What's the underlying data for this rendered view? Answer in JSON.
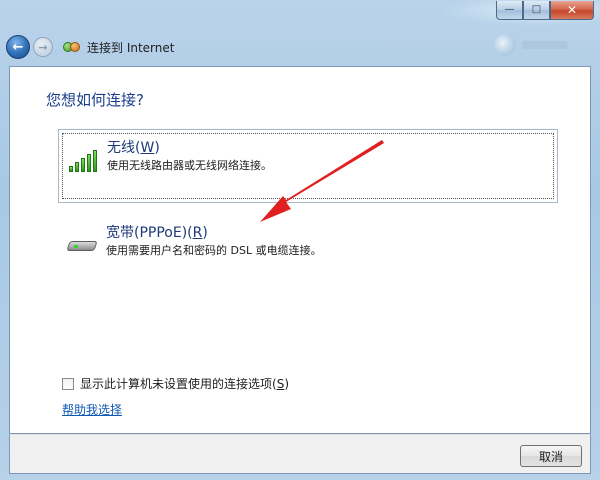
{
  "window": {
    "title": "连接到 Internet",
    "caption": {
      "minimize": "—",
      "maximize": "□",
      "close": "✕"
    }
  },
  "nav": {
    "back_icon": "back-arrow-icon",
    "forward_icon": "forward-arrow-icon"
  },
  "content": {
    "question": "您想如何连接?",
    "options": [
      {
        "title": "无线(",
        "accel": "W",
        "title_end": ")",
        "desc": "使用无线路由器或无线网络连接。",
        "icon": "wireless-signal-icon",
        "selected": true
      },
      {
        "title": "宽带(PPPoE)(",
        "accel": "R",
        "title_end": ")",
        "desc": "使用需要用户名和密码的 DSL 或电缆连接。",
        "icon": "broadband-modem-icon",
        "selected": false
      }
    ],
    "checkbox": {
      "label": "显示此计算机未设置使用的连接选项(",
      "accel": "S",
      "label_end": ")",
      "checked": false
    },
    "help_link": "帮助我选择"
  },
  "footer": {
    "cancel": "取消"
  },
  "colors": {
    "heading": "#1a3e8c",
    "link": "#0f5ab4",
    "arrow": "#e02020"
  }
}
